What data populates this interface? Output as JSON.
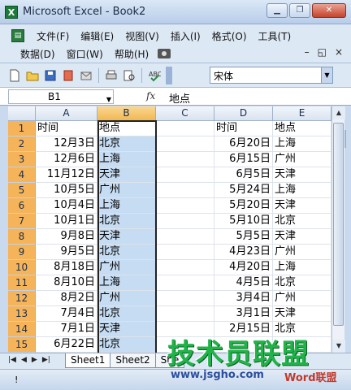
{
  "window": {
    "title": "Microsoft Excel - Book2",
    "app_icon": "excel-icon"
  },
  "menu": {
    "row1": [
      "文件(F)",
      "编辑(E)",
      "视图(V)",
      "插入(I)",
      "格式(O)",
      "工具(T)"
    ],
    "row2": [
      "数据(D)",
      "窗口(W)",
      "帮助(H)"
    ]
  },
  "toolbar": {
    "font_name": "宋体"
  },
  "formula_bar": {
    "name_box": "B1",
    "fx_label": "fx",
    "value": "地点"
  },
  "grid": {
    "columns": [
      "A",
      "B",
      "C",
      "D",
      "E"
    ],
    "selected_column": "B",
    "rows": [
      {
        "n": "1",
        "a": "时间",
        "b": "地点",
        "c": "",
        "d": "时间",
        "e": "地点"
      },
      {
        "n": "2",
        "a": "12月3日",
        "b": "北京",
        "c": "",
        "d": "6月20日",
        "e": "上海"
      },
      {
        "n": "3",
        "a": "12月6日",
        "b": "上海",
        "c": "",
        "d": "6月15日",
        "e": "广州"
      },
      {
        "n": "4",
        "a": "11月12日",
        "b": "天津",
        "c": "",
        "d": "6月5日",
        "e": "天津"
      },
      {
        "n": "5",
        "a": "10月5日",
        "b": "广州",
        "c": "",
        "d": "5月24日",
        "e": "上海"
      },
      {
        "n": "6",
        "a": "10月4日",
        "b": "上海",
        "c": "",
        "d": "5月20日",
        "e": "天津"
      },
      {
        "n": "7",
        "a": "10月1日",
        "b": "北京",
        "c": "",
        "d": "5月10日",
        "e": "北京"
      },
      {
        "n": "8",
        "a": "9月8日",
        "b": "天津",
        "c": "",
        "d": "5月5日",
        "e": "天津"
      },
      {
        "n": "9",
        "a": "9月5日",
        "b": "北京",
        "c": "",
        "d": "4月23日",
        "e": "广州"
      },
      {
        "n": "10",
        "a": "8月18日",
        "b": "广州",
        "c": "",
        "d": "4月20日",
        "e": "上海"
      },
      {
        "n": "11",
        "a": "8月10日",
        "b": "上海",
        "c": "",
        "d": "4月5日",
        "e": "北京"
      },
      {
        "n": "12",
        "a": "8月2日",
        "b": "广州",
        "c": "",
        "d": "3月4日",
        "e": "广州"
      },
      {
        "n": "13",
        "a": "7月4日",
        "b": "北京",
        "c": "",
        "d": "3月1日",
        "e": "天津"
      },
      {
        "n": "14",
        "a": "7月1日",
        "b": "天津",
        "c": "",
        "d": "2月15日",
        "e": "北京"
      },
      {
        "n": "15",
        "a": "6月22日",
        "b": "北京",
        "c": "",
        "d": "",
        "e": ""
      }
    ]
  },
  "sheets": [
    "Sheet1",
    "Sheet2",
    "She"
  ],
  "watermark": {
    "title": "技术员联盟",
    "url": "www.jsgho.com",
    "word": "Word联盟"
  }
}
